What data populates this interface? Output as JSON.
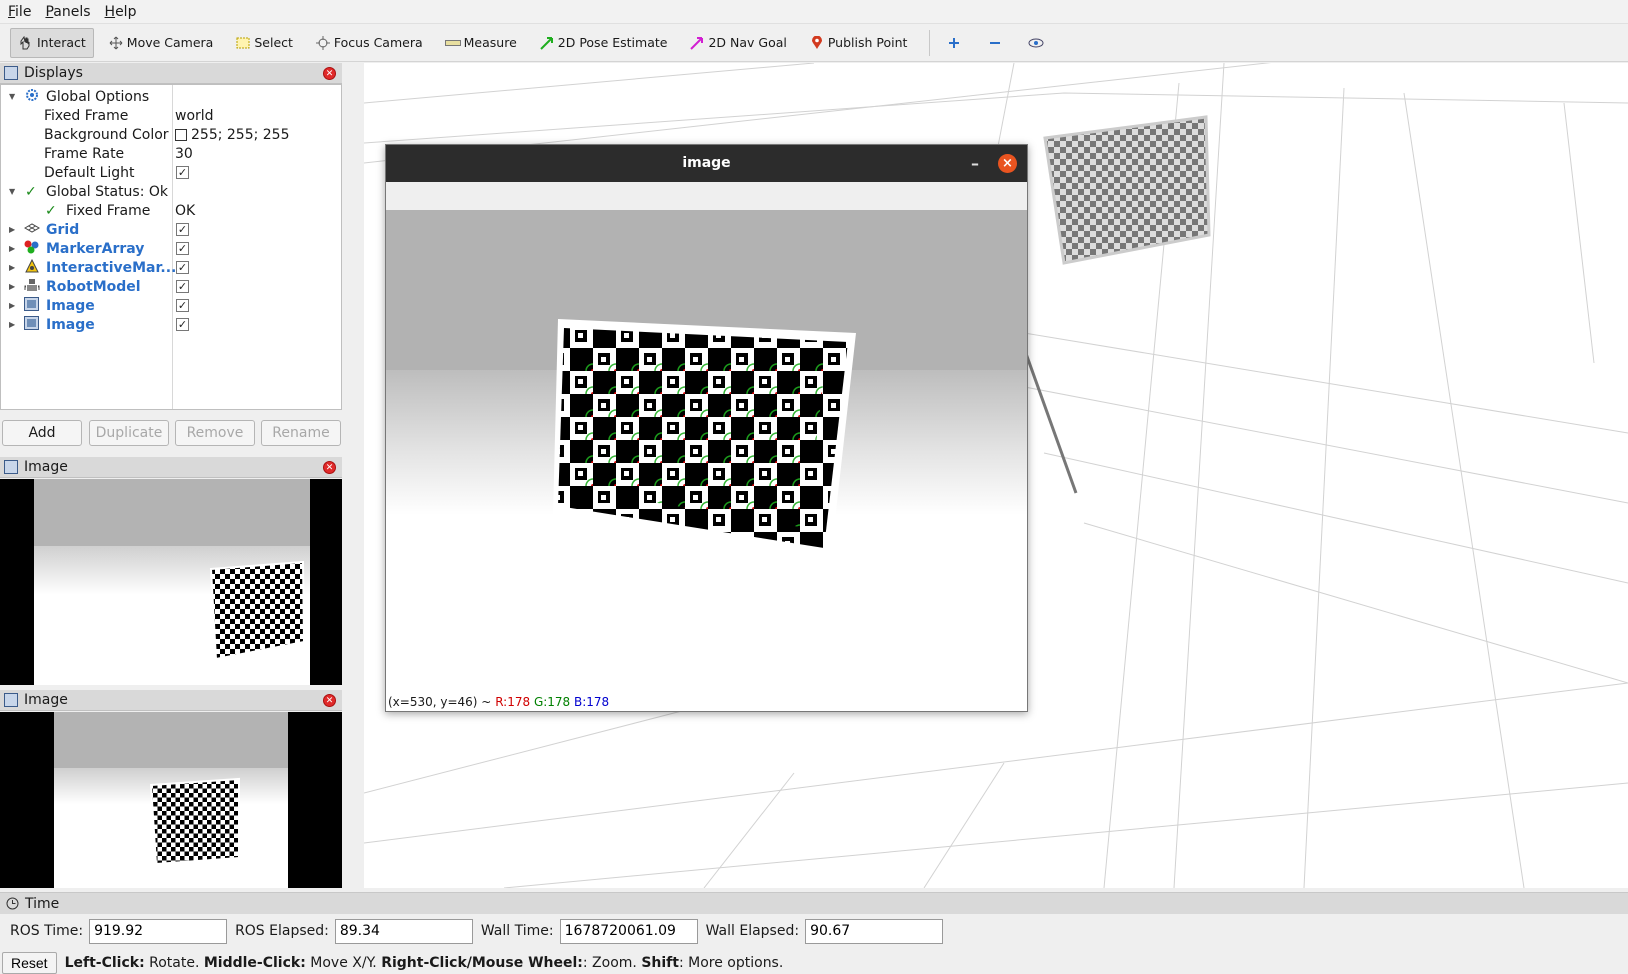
{
  "menu": [
    "File",
    "Panels",
    "Help"
  ],
  "toolbar": {
    "tools": [
      "Interact",
      "Move Camera",
      "Select",
      "Focus Camera",
      "Measure",
      "2D Pose Estimate",
      "2D Nav Goal",
      "Publish Point"
    ]
  },
  "displays": {
    "title": "Displays",
    "global_options": "Global Options",
    "fixed_frame_label": "Fixed Frame",
    "fixed_frame_value": "world",
    "background_color_label": "Background Color",
    "background_color_value": "255; 255; 255",
    "frame_rate_label": "Frame Rate",
    "frame_rate_value": "30",
    "default_light_label": "Default Light",
    "global_status": "Global Status: Ok",
    "status_fixed_frame_label": "Fixed Frame",
    "status_fixed_frame_value": "OK",
    "items": [
      "Grid",
      "MarkerArray",
      "InteractiveMar...",
      "RobotModel",
      "Image",
      "Image"
    ]
  },
  "buttons": {
    "add": "Add",
    "duplicate": "Duplicate",
    "remove": "Remove",
    "rename": "Rename"
  },
  "image_panel_1": {
    "title": "Image"
  },
  "image_panel_2": {
    "title": "Image"
  },
  "image_window": {
    "title": "image",
    "coords": "(x=530, y=46) ~",
    "r": "R:178",
    "g": "G:178",
    "b": "B:178",
    "minimize": "–",
    "close": "×"
  },
  "time": {
    "title": "Time",
    "ros_time_label": "ROS Time:",
    "ros_time": "919.92",
    "ros_elapsed_label": "ROS Elapsed:",
    "ros_elapsed": "89.34",
    "wall_time_label": "Wall Time:",
    "wall_time": "1678720061.09",
    "wall_elapsed_label": "Wall Elapsed:",
    "wall_elapsed": "90.67"
  },
  "status": {
    "reset": "Reset",
    "left_click": "Left-Click:",
    "left_click_desc": " Rotate. ",
    "middle_click": "Middle-Click:",
    "middle_click_desc": " Move X/Y. ",
    "right_click": "Right-Click/Mouse Wheel:",
    "right_click_desc": ": Zoom. ",
    "shift": "Shift",
    "shift_desc": ": More options."
  },
  "colors": {
    "accent": "#2a6fc9",
    "close": "#e95420",
    "red": "#d00000",
    "green": "#008000",
    "blue": "#0000d0"
  }
}
